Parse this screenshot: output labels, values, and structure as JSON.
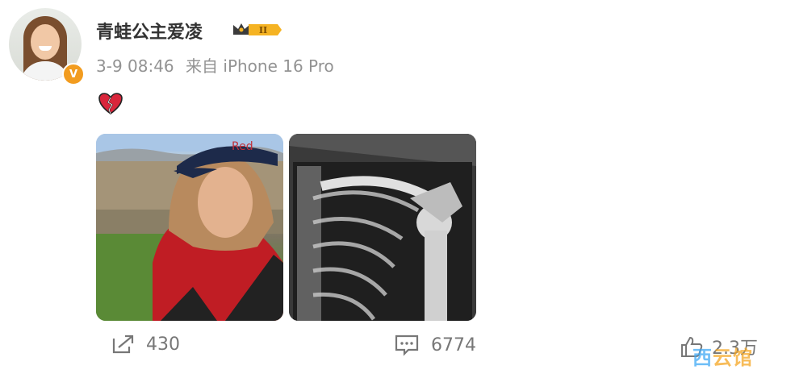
{
  "user": {
    "name": "青蛙公主爱凌",
    "verified_mark": "V",
    "level_badge": "II"
  },
  "post": {
    "time": "3-9 08:46",
    "source": "来自 iPhone 16 Pro",
    "emoji": "broken-heart-emoji",
    "images": [
      {
        "name": "selfie-photo",
        "icon": "photo"
      },
      {
        "name": "xray-photo",
        "icon": "photo"
      }
    ]
  },
  "actions": {
    "share_count": "430",
    "comment_count": "6774",
    "like_count": "2.3万"
  },
  "watermark": {
    "part1": "西",
    "part2": "云馆"
  },
  "colors": {
    "verified": "#f29c1f",
    "badge_gold": "#f5b323",
    "meta_text": "#939393",
    "watermark_blue": "#3fa9f5"
  }
}
